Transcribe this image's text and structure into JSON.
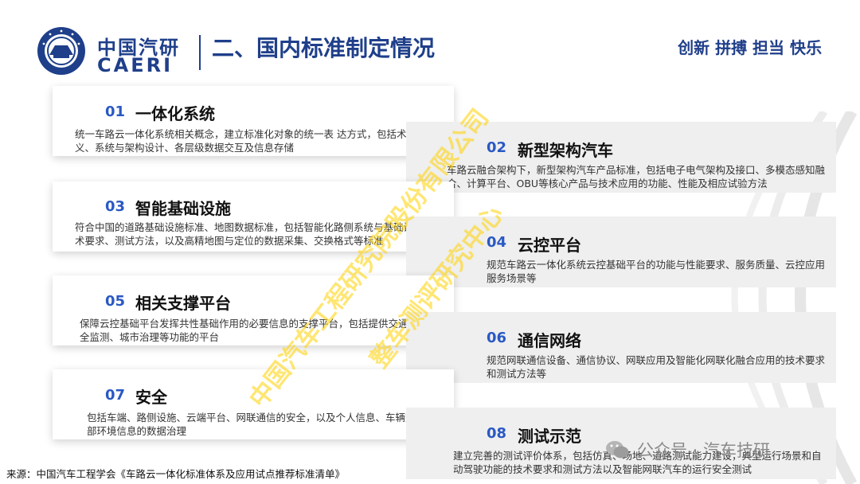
{
  "header": {
    "logo_cn": "中国汽研",
    "logo_en": "CAERI",
    "page_title": "二、国内标准制定情况",
    "slogan": "创新 拼搏 担当 快乐"
  },
  "cards": [
    {
      "num": "01",
      "title": "一体化系统",
      "desc": "统一车路云一体化系统相关概念，建立标准化对象的统一表 达方式，包括术语和定义、系统与架构设计、各层级数据交互及信息存储"
    },
    {
      "num": "02",
      "title": "新型架构汽车",
      "desc": "车路云融合架构下，新型架构汽车产品标准，包括电子电气架构及接口、多模态感知融合、计算平台、OBU等核心产品与技术应用的功能、性能及相应试验方法"
    },
    {
      "num": "03",
      "title": "智能基础设施",
      "desc": "符合中国的道路基础设施标准、地图数据标准，包括智能化路侧系统与基础设施的技术要求、测试方法，以及高精地图与定位的数据采集、交换格式等标准"
    },
    {
      "num": "04",
      "title": "云控平台",
      "desc": "规范车路云一体化系统云控基础平台的功能与性能要求、服务质量、云控应用服务场景等"
    },
    {
      "num": "05",
      "title": "相关支撑平台",
      "desc": "保障云控基础平台发挥共性基础作用的必要信息的支撑平台，包括提供交通管理、安全监测、城市治理等功能的平台"
    },
    {
      "num": "06",
      "title": "通信网络",
      "desc": "规范网联通信设备、通信协议、网联应用及智能化网联化融合应用的技术要求和测试方法等"
    },
    {
      "num": "07",
      "title": "安全",
      "desc": "包括车端、路侧设施、云端平台、网联通信的安全，以及个人信息、车辆数据、外部环境信息的数据治理"
    },
    {
      "num": "08",
      "title": "测试示范",
      "desc": "建立完善的测试评价体系，包括仿真、场地、道路测试能力建设，典型运行场景和自动驾驶功能的技术要求和测试方法以及智能网联汽车的运行安全测试"
    }
  ],
  "watermark": {
    "line1": "中国汽车工程研究院股份有限公司",
    "line2": "整车测评研究中心"
  },
  "wechat": {
    "label": "公众号 · 汽车技研"
  },
  "source": "来源：中国汽车工程学会《车路云一体化标准体系及应用试点推荐标准清单》",
  "colors": {
    "primary": "#1f3f8a",
    "number_blue": "#2a59c4",
    "watermark": "#ffd200"
  }
}
